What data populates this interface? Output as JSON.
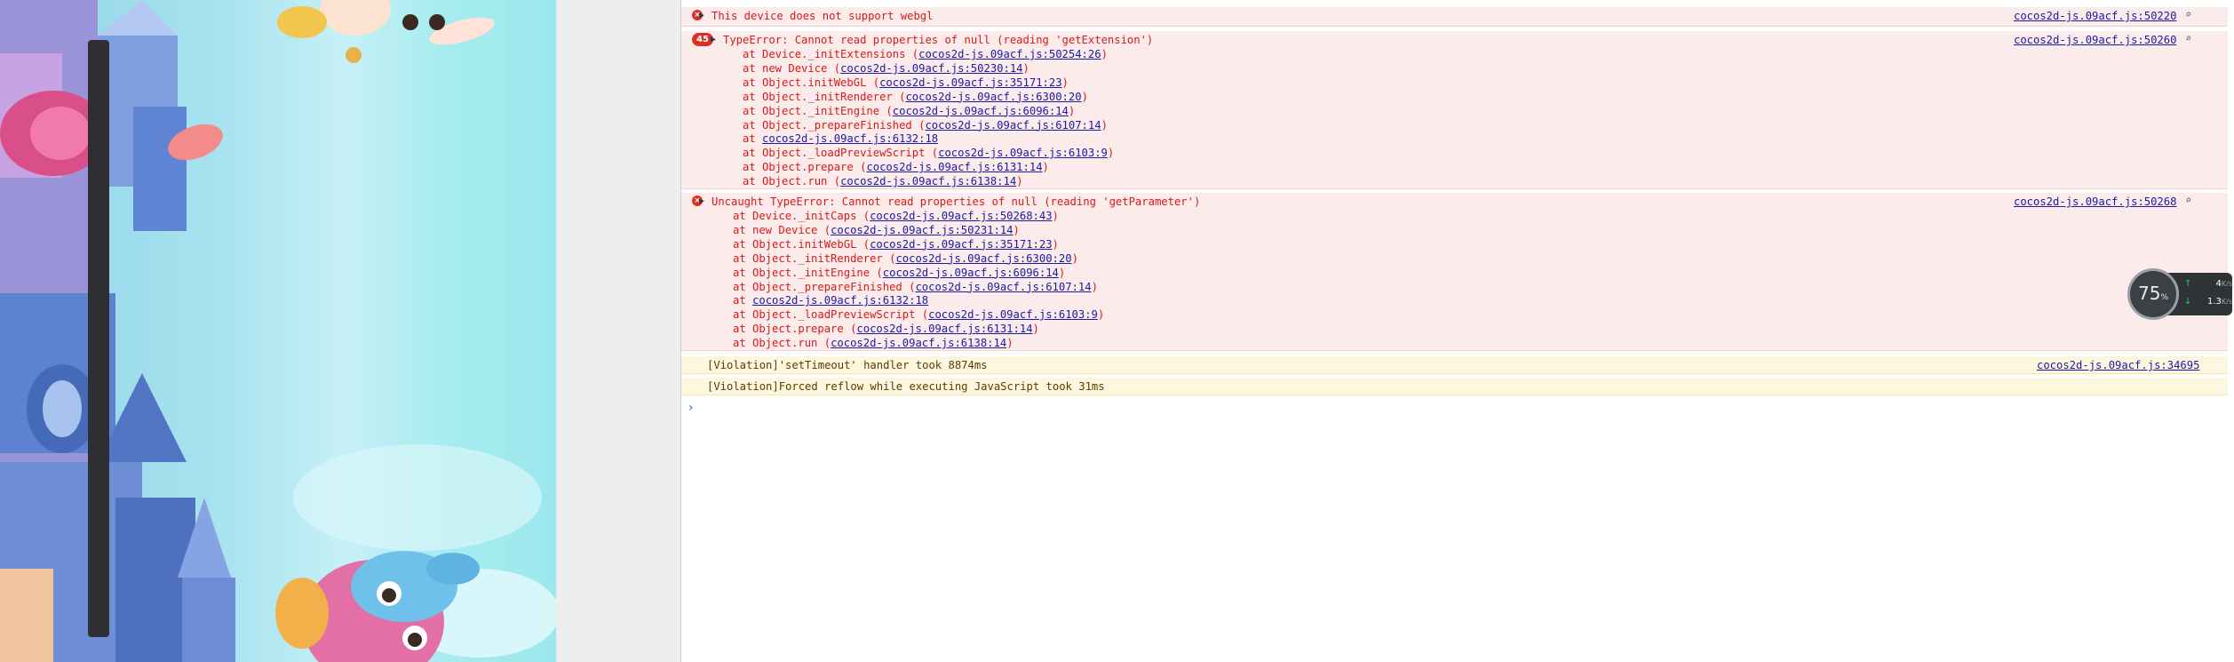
{
  "console": {
    "messages": [
      {
        "type": "error",
        "text": "This device does not support webgl",
        "source": "cocos2d-js.09acf.js:50220"
      },
      {
        "type": "error",
        "count": "45",
        "text": "TypeError: Cannot read properties of null (reading 'getExtension')",
        "source": "cocos2d-js.09acf.js:50260",
        "stack": [
          {
            "prefix": "at Device._initExtensions (",
            "link": "cocos2d-js.09acf.js:50254:26",
            "suffix": ")"
          },
          {
            "prefix": "at new Device (",
            "link": "cocos2d-js.09acf.js:50230:14",
            "suffix": ")"
          },
          {
            "prefix": "at Object.initWebGL (",
            "link": "cocos2d-js.09acf.js:35171:23",
            "suffix": ")"
          },
          {
            "prefix": "at Object._initRenderer (",
            "link": "cocos2d-js.09acf.js:6300:20",
            "suffix": ")"
          },
          {
            "prefix": "at Object._initEngine (",
            "link": "cocos2d-js.09acf.js:6096:14",
            "suffix": ")"
          },
          {
            "prefix": "at Object._prepareFinished (",
            "link": "cocos2d-js.09acf.js:6107:14",
            "suffix": ")"
          },
          {
            "prefix": "at ",
            "link": "cocos2d-js.09acf.js:6132:18",
            "suffix": ""
          },
          {
            "prefix": "at Object._loadPreviewScript (",
            "link": "cocos2d-js.09acf.js:6103:9",
            "suffix": ")"
          },
          {
            "prefix": "at Object.prepare (",
            "link": "cocos2d-js.09acf.js:6131:14",
            "suffix": ")"
          },
          {
            "prefix": "at Object.run (",
            "link": "cocos2d-js.09acf.js:6138:14",
            "suffix": ")"
          }
        ]
      },
      {
        "type": "error",
        "text": "Uncaught TypeError: Cannot read properties of null (reading 'getParameter')",
        "source": "cocos2d-js.09acf.js:50268",
        "stack": [
          {
            "prefix": "at Device._initCaps (",
            "link": "cocos2d-js.09acf.js:50268:43",
            "suffix": ")"
          },
          {
            "prefix": "at new Device (",
            "link": "cocos2d-js.09acf.js:50231:14",
            "suffix": ")"
          },
          {
            "prefix": "at Object.initWebGL (",
            "link": "cocos2d-js.09acf.js:35171:23",
            "suffix": ")"
          },
          {
            "prefix": "at Object._initRenderer (",
            "link": "cocos2d-js.09acf.js:6300:20",
            "suffix": ")"
          },
          {
            "prefix": "at Object._initEngine (",
            "link": "cocos2d-js.09acf.js:6096:14",
            "suffix": ")"
          },
          {
            "prefix": "at Object._prepareFinished (",
            "link": "cocos2d-js.09acf.js:6107:14",
            "suffix": ")"
          },
          {
            "prefix": "at ",
            "link": "cocos2d-js.09acf.js:6132:18",
            "suffix": ""
          },
          {
            "prefix": "at Object._loadPreviewScript (",
            "link": "cocos2d-js.09acf.js:6103:9",
            "suffix": ")"
          },
          {
            "prefix": "at Object.prepare (",
            "link": "cocos2d-js.09acf.js:6131:14",
            "suffix": ")"
          },
          {
            "prefix": "at Object.run (",
            "link": "cocos2d-js.09acf.js:6138:14",
            "suffix": ")"
          }
        ]
      },
      {
        "type": "warn",
        "text": "[Violation]'setTimeout' handler took 8874ms",
        "source": "cocos2d-js.09acf.js:34695"
      },
      {
        "type": "warn",
        "text": "[Violation]Forced reflow while executing JavaScript took 31ms",
        "source": ""
      }
    ],
    "prompt_icon": "chevron-right-icon"
  },
  "network_widget": {
    "percent": "75",
    "percent_unit": "%",
    "upload": "4",
    "upload_unit": "K/s",
    "download": "1.3",
    "download_unit": "K/s"
  },
  "colors": {
    "error_bg": "#fcebeb",
    "error_text": "#d91919",
    "warn_bg": "#fef7e0",
    "link": "#1a1aa6"
  }
}
